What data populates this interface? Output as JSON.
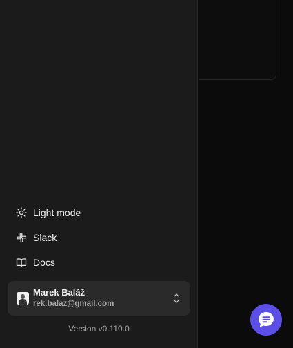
{
  "sidebar": {
    "items": [
      {
        "label": "Light mode",
        "icon": "sun-icon"
      },
      {
        "label": "Slack",
        "icon": "slack-icon"
      },
      {
        "label": "Docs",
        "icon": "book-icon"
      }
    ],
    "user": {
      "name": "Marek Baláž",
      "email": "rek.balaz@gmail.com"
    },
    "version": "Version v0.110.0"
  },
  "colors": {
    "sidebar_bg": "#1b1b1b",
    "main_bg": "#0b0b0b",
    "card_bg": "#2a2a2a",
    "chat_accent": "#5b4fe8"
  },
  "chat": {
    "icon": "chat-bubble-icon"
  }
}
